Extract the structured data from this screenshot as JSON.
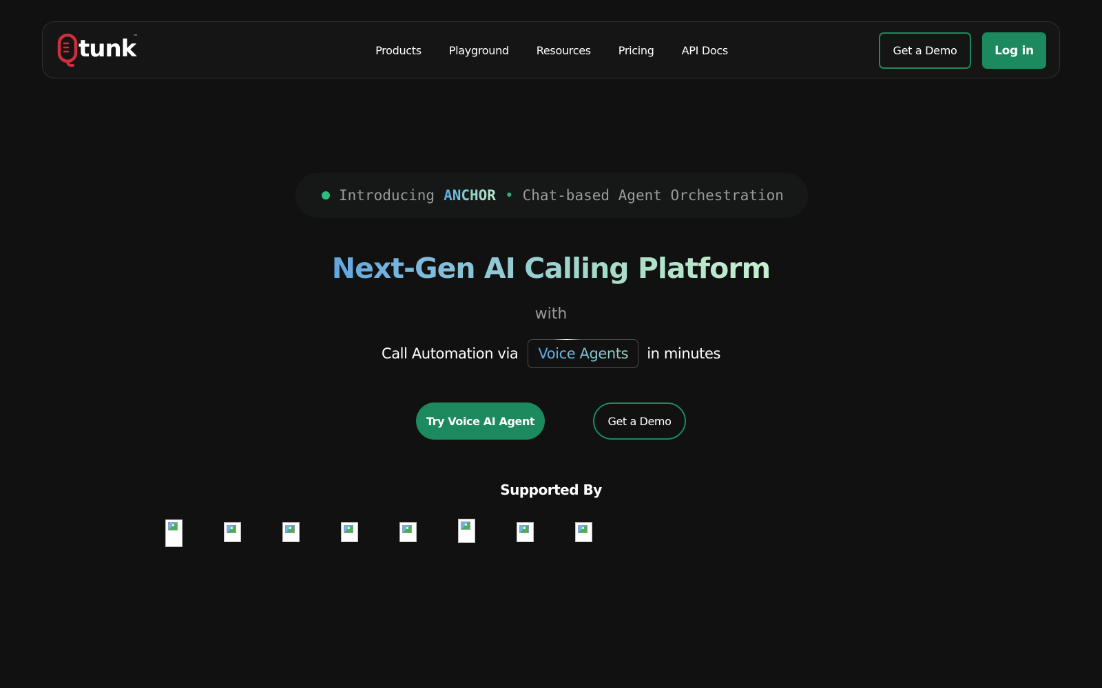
{
  "brand": {
    "name": "tunk",
    "trademark": "™",
    "accent_color": "#1c8a5e",
    "logo_color": "#d12d3a"
  },
  "nav": {
    "links": [
      "Products",
      "Playground",
      "Resources",
      "Pricing",
      "API Docs"
    ],
    "demo_button": "Get a Demo",
    "login_button": "Log in"
  },
  "announcement": {
    "prefix": "Introducing",
    "highlight": "ANCHOR",
    "separator": "•",
    "suffix": "Chat-based Agent Orchestration",
    "dot_color": "#2ebd7c"
  },
  "hero": {
    "title": "Next-Gen AI Calling Platform",
    "with": "with",
    "sub_before": "Call Automation via",
    "sub_highlight": "Voice Agents",
    "sub_after": "in minutes",
    "primary_cta": "Try Voice AI Agent",
    "secondary_cta": "Get a Demo"
  },
  "supported": {
    "title": "Supported By",
    "logo_count": 8,
    "logo_icon": "broken-image-icon"
  }
}
